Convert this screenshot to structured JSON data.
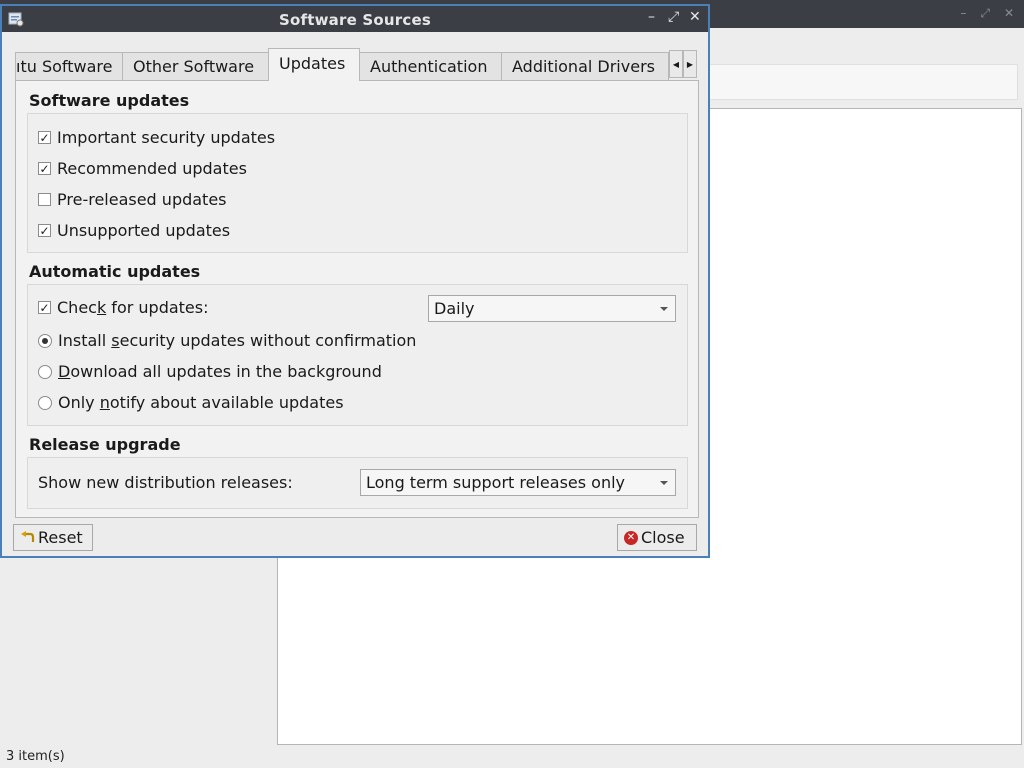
{
  "background": {
    "status_text": "3 item(s)"
  },
  "dialog": {
    "title": "Software Sources",
    "controls": {
      "minimize": "–",
      "maximize": "⤢",
      "close": "✕"
    },
    "tabs": [
      {
        "label": "ıtu Software"
      },
      {
        "label": "Other Software"
      },
      {
        "label": "Updates"
      },
      {
        "label": "Authentication"
      },
      {
        "label": "Additional Drivers"
      }
    ],
    "active_tab": "Updates",
    "software_updates": {
      "title": "Software updates",
      "items": [
        {
          "label": "Important security updates",
          "checked": true
        },
        {
          "label": "Recommended updates",
          "checked": true
        },
        {
          "label": "Pre-released updates",
          "checked": false
        },
        {
          "label": "Unsupported updates",
          "checked": true
        }
      ]
    },
    "automatic_updates": {
      "title": "Automatic updates",
      "check_label_pre": "Chec",
      "check_label_mn": "k",
      "check_label_post": " for updates:",
      "check_checked": true,
      "frequency": "Daily",
      "radios": [
        {
          "pre": "Install ",
          "mn": "s",
          "post": "ecurity updates without confirmation",
          "selected": true
        },
        {
          "pre": "",
          "mn": "D",
          "post": "ownload all updates in the background",
          "selected": false
        },
        {
          "pre": "Only ",
          "mn": "n",
          "post": "otify about available updates",
          "selected": false
        }
      ]
    },
    "release_upgrade": {
      "title": "Release upgrade",
      "label": "Show new distribution releases:",
      "value": "Long term support releases only"
    },
    "buttons": {
      "reset": "Reset",
      "close": "Close"
    }
  }
}
